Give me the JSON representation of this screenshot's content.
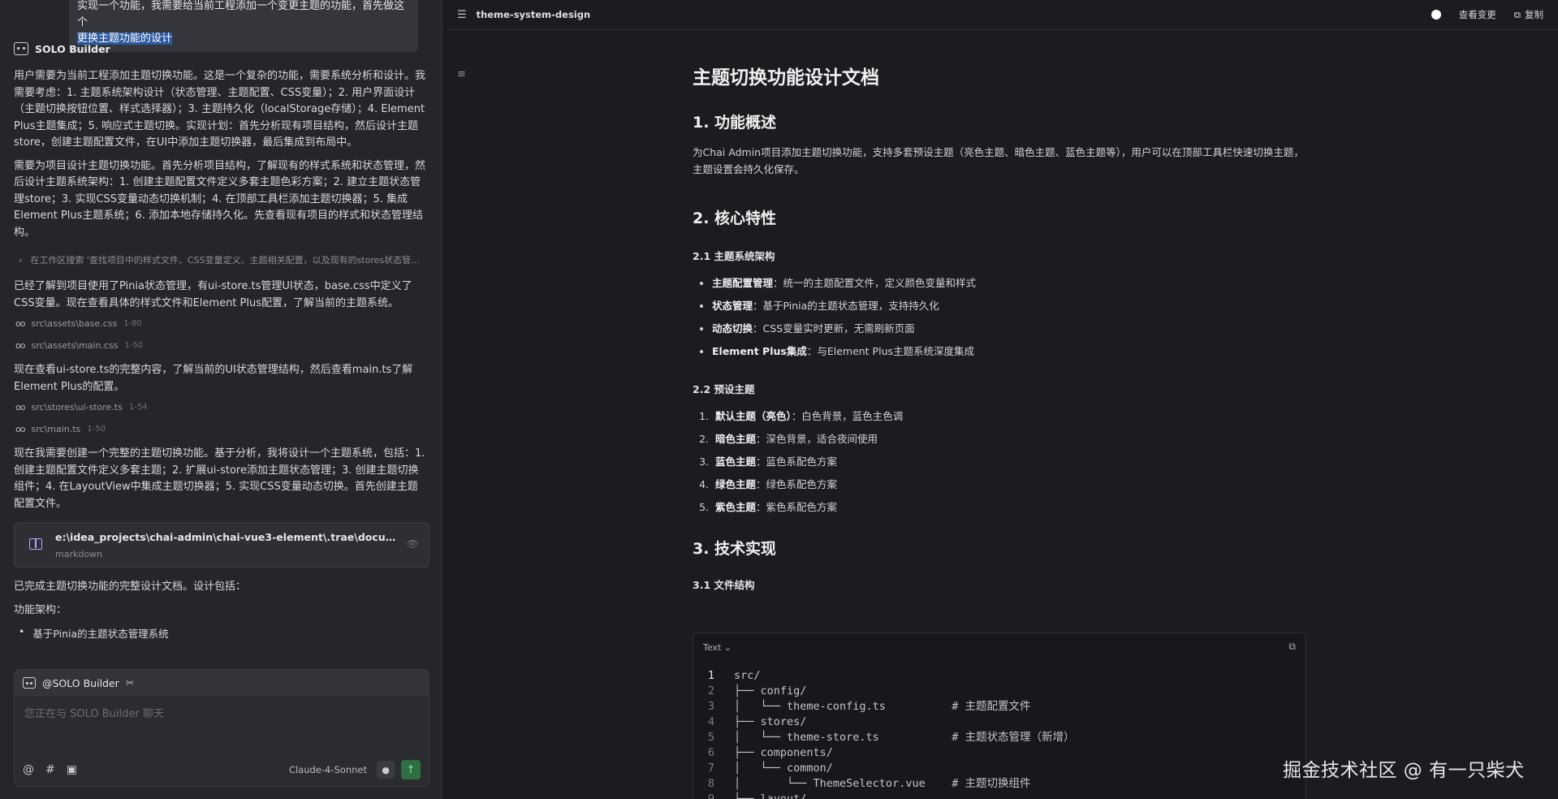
{
  "chat": {
    "user_message_line1": "实现一个功能，我需要给当前工程添加一个变更主题的功能，首先做这个",
    "user_message_line2": "更换主题功能的设计",
    "agent_name": "SOLO Builder",
    "paragraphs": [
      "用户需要为当前工程添加主题切换功能。这是一个复杂的功能，需要系统分析和设计。我需要考虑：1. 主题系统架构设计（状态管理、主题配置、CSS变量）；2. 用户界面设计（主题切换按钮位置、样式选择器）；3. 主题持久化（localStorage存储）；4. Element Plus主题集成；5. 响应式主题切换。实现计划：首先分析现有项目结构，然后设计主题store，创建主题配置文件，在UI中添加主题切换器，最后集成到布局中。",
      "需要为项目设计主题切换功能。首先分析项目结构，了解现有的样式系统和状态管理，然后设计主题系统架构：1. 创建主题配置文件定义多套主题色彩方案；2. 建立主题状态管理store；3. 实现CSS变量动态切换机制；4. 在顶部工具栏添加主题切换器；5. 集成Element Plus主题系统；6. 添加本地存储持久化。先查看现有项目的样式和状态管理结构。",
      "已经了解到项目使用了Pinia状态管理，有ui-store.ts管理UI状态，base.css中定义了CSS变量。现在查看具体的样式文件和Element Plus配置，了解当前的主题系统。",
      "现在查看ui-store.ts的完整内容，了解当前的UI状态管理结构，然后查看main.ts了解Element Plus的配置。",
      "现在我需要创建一个完整的主题切换功能。基于分析，我将设计一个主题系统，包括：1. 创建主题配置文件定义多套主题；2. 扩展ui-store添加主题状态管理；3. 创建主题切换组件；4. 在LayoutView中集成主题切换器；5. 实现CSS变量动态切换。首先创建主题配置文件。",
      "已完成主题切换功能的完整设计文档。设计包括：",
      "功能架构："
    ],
    "search_step": "在工作区搜索 '查找项目中的样式文件、CSS变量定义、主题相关配置，以及现有的stores状态管...",
    "files_a": [
      {
        "path": "src\\assets\\base.css",
        "range": "1-80"
      },
      {
        "path": "src\\assets\\main.css",
        "range": "1-50"
      }
    ],
    "files_b": [
      {
        "path": "src\\stores\\ui-store.ts",
        "range": "1-54"
      },
      {
        "path": "src\\main.ts",
        "range": "1-50"
      }
    ],
    "doc_card": {
      "path": "e:\\idea_projects\\chai-admin\\chai-vue3-element\\.trae\\documents\\theme-system-design.md",
      "kind": "markdown"
    },
    "bullet": "基于Pinia的主题状态管理系统",
    "composer": {
      "mention": "@SOLO Builder",
      "placeholder": "您正在与 SOLO Builder 聊天",
      "model": "Claude-4-Sonnet"
    }
  },
  "doc": {
    "tab_title": "theme-system-design",
    "view_changes": "查看变更",
    "copy": "复制",
    "h1": "主题切换功能设计文档",
    "s1_title": "1. 功能概述",
    "s1_text": "为Chai Admin项目添加主题切换功能，支持多套预设主题（亮色主题、暗色主题、蓝色主题等），用户可以在顶部工具栏快速切换主题，主题设置会持久化保存。",
    "s2_title": "2. 核心特性",
    "s21_title": "2.1 主题系统架构",
    "s21_items": [
      {
        "b": "主题配置管理",
        "t": "：统一的主题配置文件，定义颜色变量和样式"
      },
      {
        "b": "状态管理",
        "t": "：基于Pinia的主题状态管理，支持持久化"
      },
      {
        "b": "动态切换",
        "t": "：CSS变量实时更新，无需刷新页面"
      },
      {
        "b": "Element Plus集成",
        "t": "：与Element Plus主题系统深度集成"
      }
    ],
    "s22_title": "2.2 预设主题",
    "s22_items": [
      {
        "b": "默认主题（亮色）",
        "t": "：白色背景，蓝色主色调"
      },
      {
        "b": "暗色主题",
        "t": "：深色背景，适合夜间使用"
      },
      {
        "b": "蓝色主题",
        "t": "：蓝色系配色方案"
      },
      {
        "b": "绿色主题",
        "t": "：绿色系配色方案"
      },
      {
        "b": "紫色主题",
        "t": "：紫色系配色方案"
      }
    ],
    "s3_title": "3. 技术实现",
    "s31_title": "3.1 文件结构",
    "code_lang": "Text",
    "code_lines": [
      {
        "no": "1",
        "text": "src/"
      },
      {
        "no": "2",
        "text": "├── config/"
      },
      {
        "no": "3",
        "text": "│   └── theme-config.ts          # 主题配置文件"
      },
      {
        "no": "4",
        "text": "├── stores/"
      },
      {
        "no": "5",
        "text": "│   └── theme-store.ts           # 主题状态管理（新增）"
      },
      {
        "no": "6",
        "text": "├── components/"
      },
      {
        "no": "7",
        "text": "│   └── common/"
      },
      {
        "no": "8",
        "text": "│       └── ThemeSelector.vue    # 主题切换组件"
      },
      {
        "no": "9",
        "text": "├── layout/"
      }
    ]
  },
  "watermark": "掘金技术社区 @ 有一只柴犬",
  "colors": {
    "accent_green": "#2f6f43",
    "selection_blue": "#2c5aa0",
    "doc_icon_purple": "#b7a5ff"
  }
}
